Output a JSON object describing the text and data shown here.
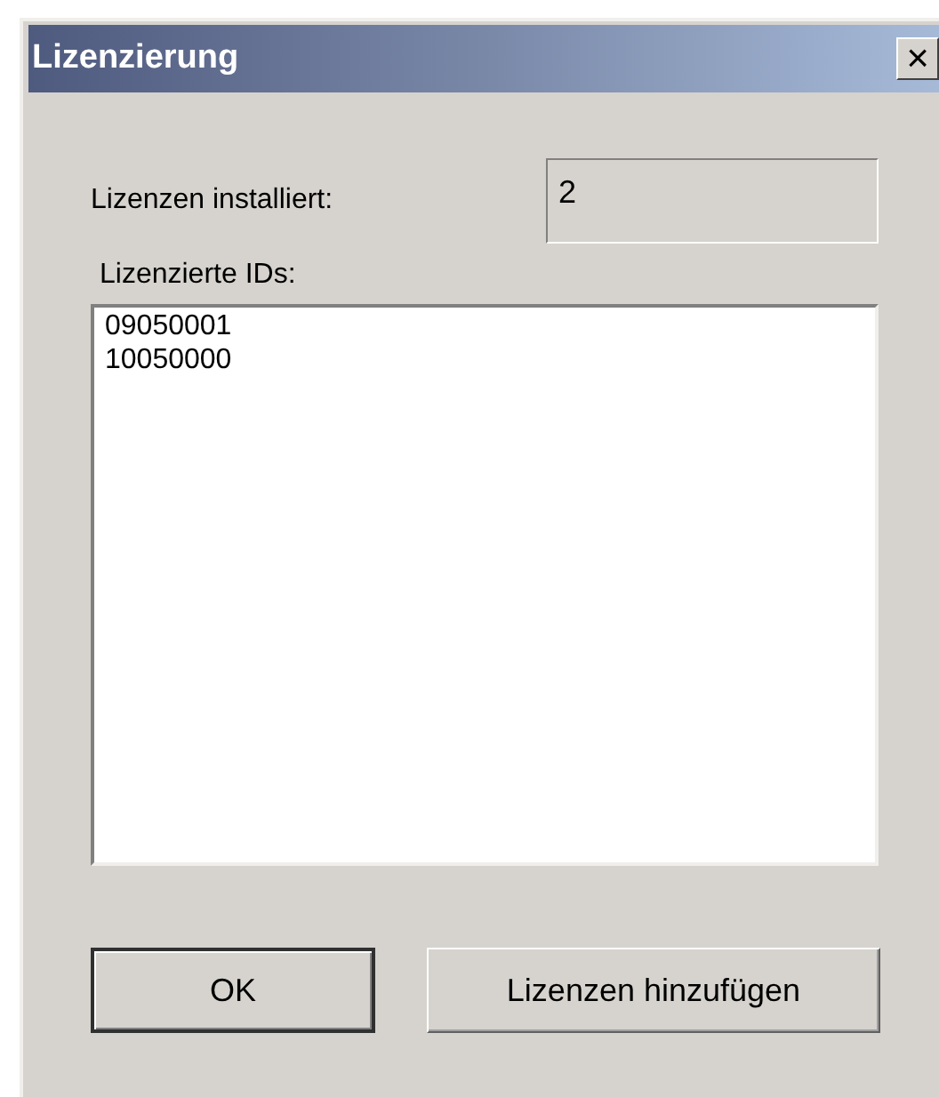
{
  "window": {
    "title": "Lizenzierung",
    "close": "×"
  },
  "installed": {
    "label": "Lizenzen installiert:",
    "value": "2"
  },
  "ids": {
    "label": "Lizenzierte IDs:",
    "items": [
      "09050001",
      "10050000"
    ]
  },
  "buttons": [
    {
      "label": "OK",
      "default": true
    },
    {
      "label": "Lizenzen hinzufügen",
      "default": false
    }
  ]
}
